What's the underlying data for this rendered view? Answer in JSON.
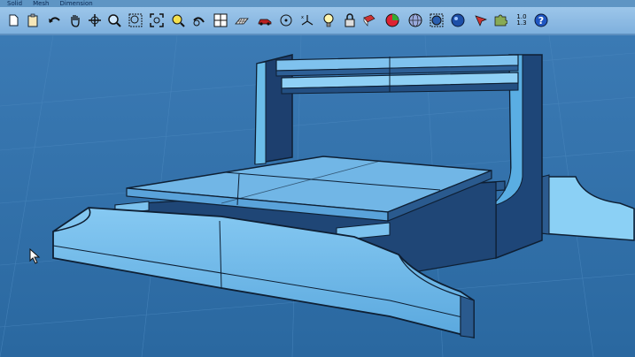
{
  "menu": [
    "Solid",
    "Mesh",
    "Dimension"
  ],
  "toolbar": {
    "tools": [
      {
        "name": "new-document-icon"
      },
      {
        "name": "clipboard-icon"
      },
      {
        "name": "undo-icon"
      },
      {
        "name": "pan-hand-icon"
      },
      {
        "name": "rotate-view-icon"
      },
      {
        "name": "zoom-icon"
      },
      {
        "name": "zoom-window-icon"
      },
      {
        "name": "zoom-extents-icon"
      },
      {
        "name": "zoom-selected-icon"
      },
      {
        "name": "redo-view-icon"
      },
      {
        "name": "four-viewports-icon"
      },
      {
        "name": "grid-plane-icon"
      },
      {
        "name": "car-icon"
      },
      {
        "name": "target-point-icon"
      },
      {
        "name": "coordinate-axes-icon"
      },
      {
        "name": "light-bulb-icon"
      },
      {
        "name": "lock-icon"
      },
      {
        "name": "red-material-icon"
      },
      {
        "name": "rendered-sphere-icon"
      },
      {
        "name": "globe-icon"
      },
      {
        "name": "blue-sphere-icon"
      },
      {
        "name": "arrow-pointer-icon"
      },
      {
        "name": "puzzle-plugin-icon"
      },
      {
        "name": "number-format-icon"
      },
      {
        "name": "help-icon"
      }
    ],
    "number_format_top": "1.0",
    "number_format_bottom": "1.3",
    "help_label": "?"
  },
  "colors": {
    "background": "#2f6fa6",
    "toolbar": "#8dbce6",
    "model_light": "#7ec4f0",
    "model_mid": "#3b8fd1",
    "model_dark": "#1a3d6b",
    "outline": "#0e1f33"
  }
}
